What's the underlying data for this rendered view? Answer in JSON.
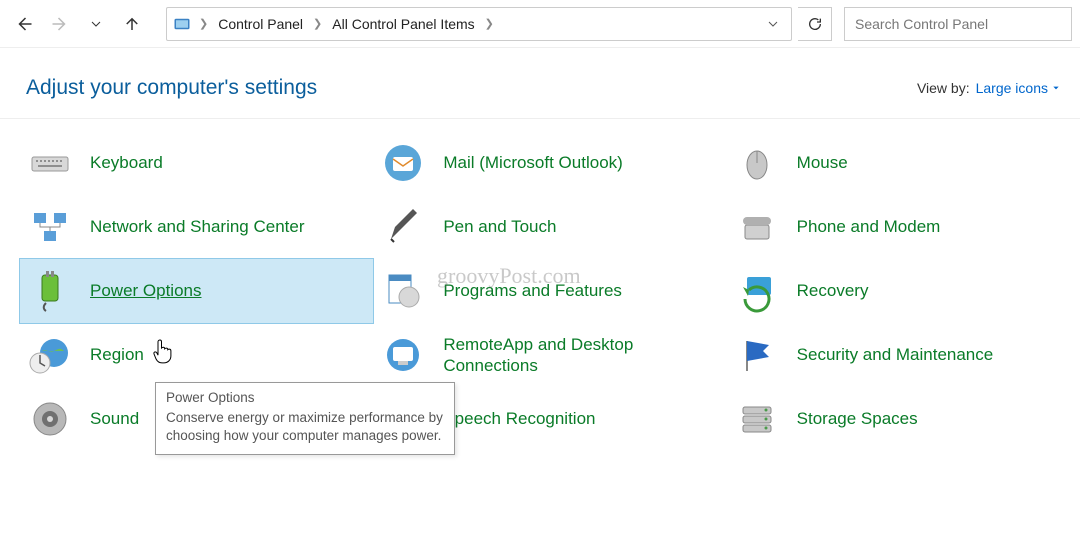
{
  "breadcrumb": {
    "items": [
      "Control Panel",
      "All Control Panel Items"
    ]
  },
  "search": {
    "placeholder": "Search Control Panel"
  },
  "header": {
    "title": "Adjust your computer's settings",
    "viewby_label": "View by:",
    "viewby_value": "Large icons"
  },
  "items": [
    {
      "label": "Keyboard"
    },
    {
      "label": "Mail (Microsoft Outlook)"
    },
    {
      "label": "Mouse"
    },
    {
      "label": "Network and Sharing Center"
    },
    {
      "label": "Pen and Touch"
    },
    {
      "label": "Phone and Modem"
    },
    {
      "label": "Power Options"
    },
    {
      "label": "Programs and Features"
    },
    {
      "label": "Recovery"
    },
    {
      "label": "Region"
    },
    {
      "label": "RemoteApp and Desktop Connections"
    },
    {
      "label": "Security and Maintenance"
    },
    {
      "label": "Sound"
    },
    {
      "label": "Speech Recognition"
    },
    {
      "label": "Storage Spaces"
    }
  ],
  "tooltip": {
    "title": "Power Options",
    "body": "Conserve energy or maximize performance by choosing how your computer manages power."
  },
  "watermark": "groovyPost.com"
}
